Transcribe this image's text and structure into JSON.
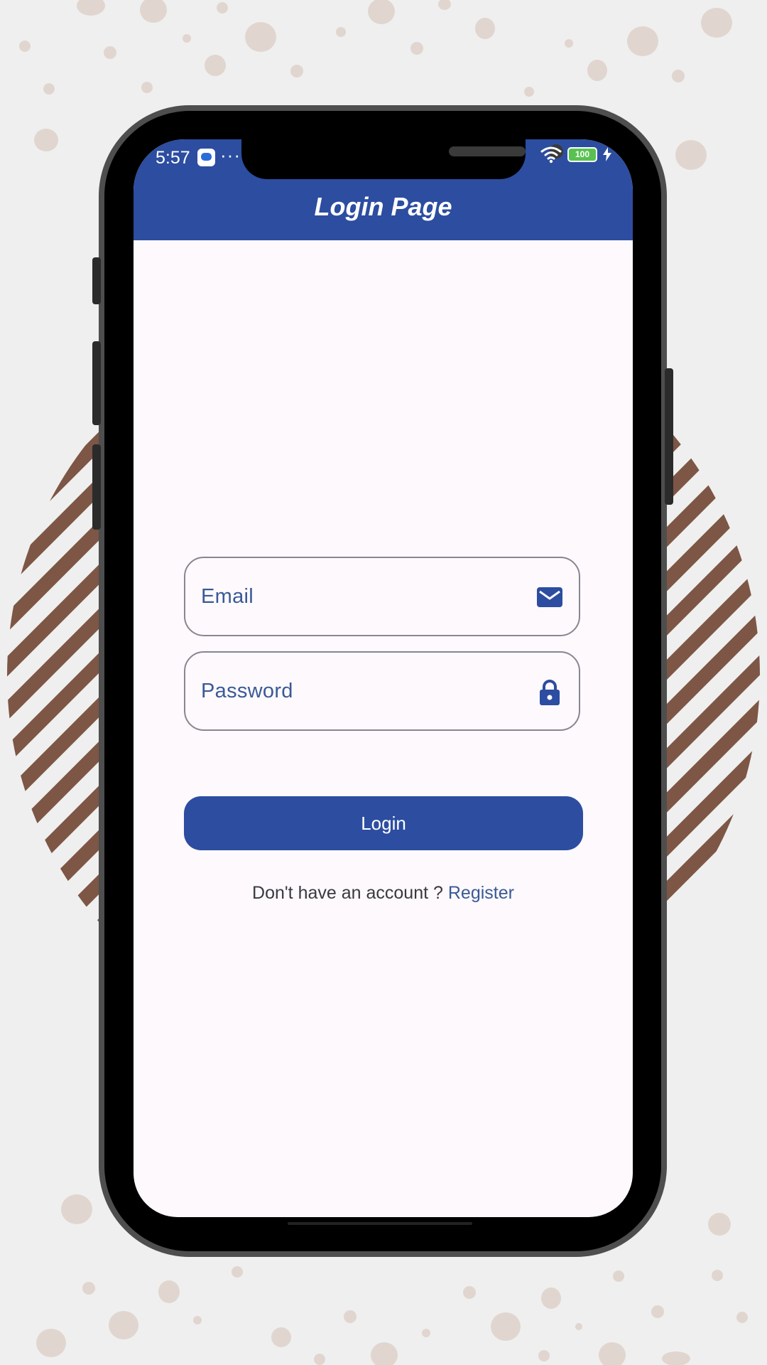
{
  "status_bar": {
    "time": "5:57",
    "dots": "···",
    "battery": "100"
  },
  "app_bar": {
    "title": "Login Page"
  },
  "form": {
    "email_placeholder": "Email",
    "password_placeholder": "Password",
    "login_label": "Login",
    "no_account_text": "Don't have an account ?",
    "register_label": "Register"
  },
  "colors": {
    "primary": "#2c4da0",
    "background": "#fdf9fc",
    "hint_text": "#3a5a96",
    "decor_stripes": "#7d5645",
    "decor_dots": "#e0d6cf"
  },
  "icons": {
    "email_field": "mail-icon",
    "password_field": "lock-icon",
    "status": [
      "chat-icon",
      "wifi-icon",
      "battery-icon",
      "charging-icon"
    ]
  }
}
